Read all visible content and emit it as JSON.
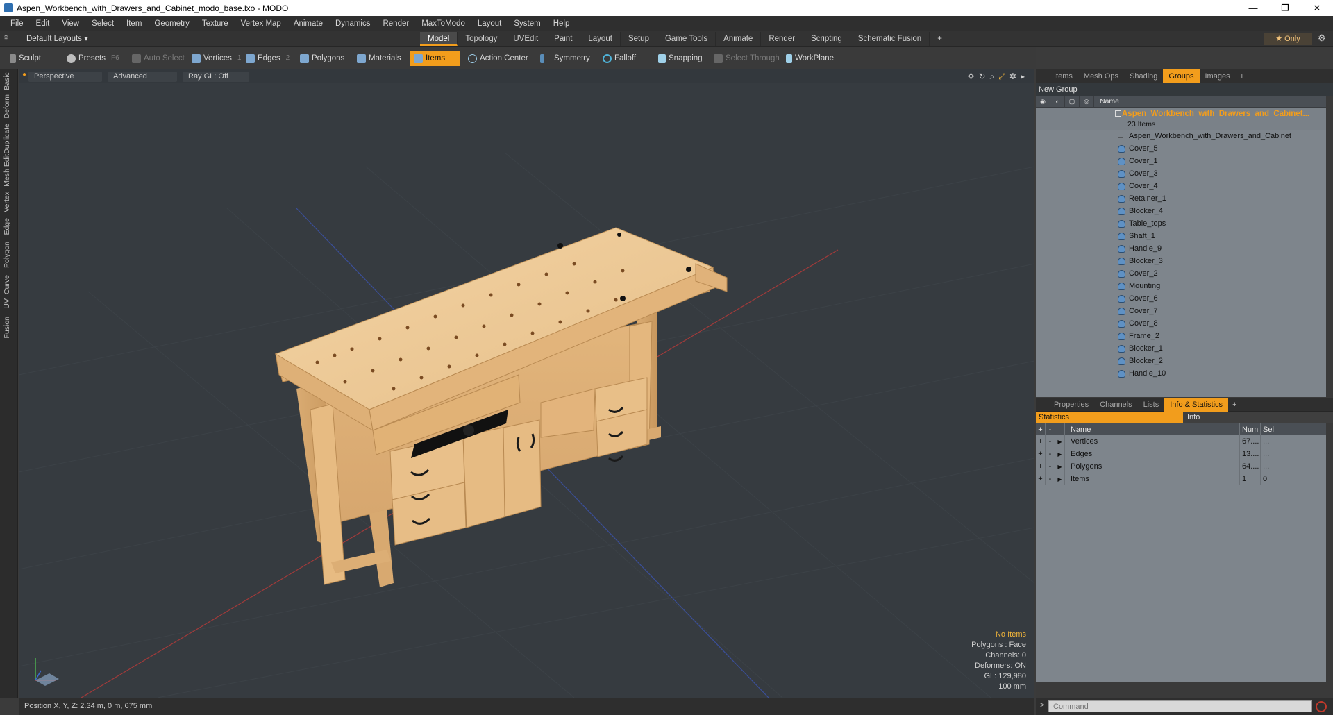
{
  "window": {
    "title": "Aspen_Workbench_with_Drawers_and_Cabinet_modo_base.lxo - MODO",
    "minimize": "—",
    "maximize": "❐",
    "close": "✕"
  },
  "menu": [
    "File",
    "Edit",
    "View",
    "Select",
    "Item",
    "Geometry",
    "Texture",
    "Vertex Map",
    "Animate",
    "Dynamics",
    "Render",
    "MaxToModo",
    "Layout",
    "System",
    "Help"
  ],
  "layout": {
    "dropdown": "Default Layouts ▾",
    "tabs": [
      "Model",
      "Topology",
      "UVEdit",
      "Paint",
      "Layout",
      "Setup",
      "Game Tools",
      "Animate",
      "Render",
      "Scripting",
      "Schematic Fusion",
      "+"
    ],
    "active_tab": "Model",
    "only": "★  Only"
  },
  "toolbar": {
    "sculpt": "Sculpt",
    "presets": "Presets",
    "presets_key": "F6",
    "auto_select": "Auto Select",
    "vertices": "Vertices",
    "vertices_n": "1",
    "edges": "Edges",
    "edges_n": "2",
    "polygons": "Polygons",
    "materials": "Materials",
    "items": "Items",
    "action_center": "Action Center",
    "symmetry": "Symmetry",
    "falloff": "Falloff",
    "snapping": "Snapping",
    "select_through": "Select Through",
    "workplane": "WorkPlane"
  },
  "left_tabs": [
    "Basic",
    "Deform",
    "Duplicate",
    "Mesh Edit",
    "Vertex",
    "Edge",
    "Polygon",
    "Curve",
    "UV",
    "Fusion"
  ],
  "viewport": {
    "perspective": "Perspective",
    "advanced": "Advanced",
    "raygl": "Ray GL: Off",
    "stats": {
      "no_items": "No Items",
      "polygons": "Polygons : Face",
      "channels": "Channels: 0",
      "deformers": "Deformers: ON",
      "gl": "GL: 129,980",
      "scale": "100 mm"
    }
  },
  "status": {
    "position": "Position X, Y, Z:   2.34 m, 0 m, 675 mm"
  },
  "groups_panel": {
    "tabs": [
      "Items",
      "Mesh Ops",
      "Shading",
      "Groups",
      "Images",
      "+"
    ],
    "active": "Groups",
    "new_group": "New Group",
    "name_header": "Name",
    "group_name": "Aspen_Workbench_with_Drawers_and_Cabinet...",
    "group_count": "23 Items",
    "locator": "Aspen_Workbench_with_Drawers_and_Cabinet",
    "items": [
      "Cover_5",
      "Cover_1",
      "Cover_3",
      "Cover_4",
      "Retainer_1",
      "Blocker_4",
      "Table_tops",
      "Shaft_1",
      "Handle_9",
      "Blocker_3",
      "Cover_2",
      "Mounting",
      "Cover_6",
      "Cover_7",
      "Cover_8",
      "Frame_2",
      "Blocker_1",
      "Blocker_2",
      "Handle_10"
    ]
  },
  "info_panel": {
    "tabs": [
      "Properties",
      "Channels",
      "Lists",
      "Info & Statistics",
      "+"
    ],
    "active": "Info & Statistics",
    "statistics": "Statistics",
    "info": "Info",
    "headers": {
      "name": "Name",
      "num": "Num",
      "sel": "Sel"
    },
    "rows": [
      {
        "name": "Vertices",
        "num": "67....",
        "sel": "..."
      },
      {
        "name": "Edges",
        "num": "13....",
        "sel": "..."
      },
      {
        "name": "Polygons",
        "num": "64....",
        "sel": "..."
      },
      {
        "name": "Items",
        "num": "1",
        "sel": "0"
      }
    ]
  },
  "command": {
    "placeholder": "Command",
    "prompt": ">"
  },
  "colors": {
    "accent": "#f29d1c",
    "viewport_bg": "#363b40",
    "wood": "#e8c38f"
  }
}
